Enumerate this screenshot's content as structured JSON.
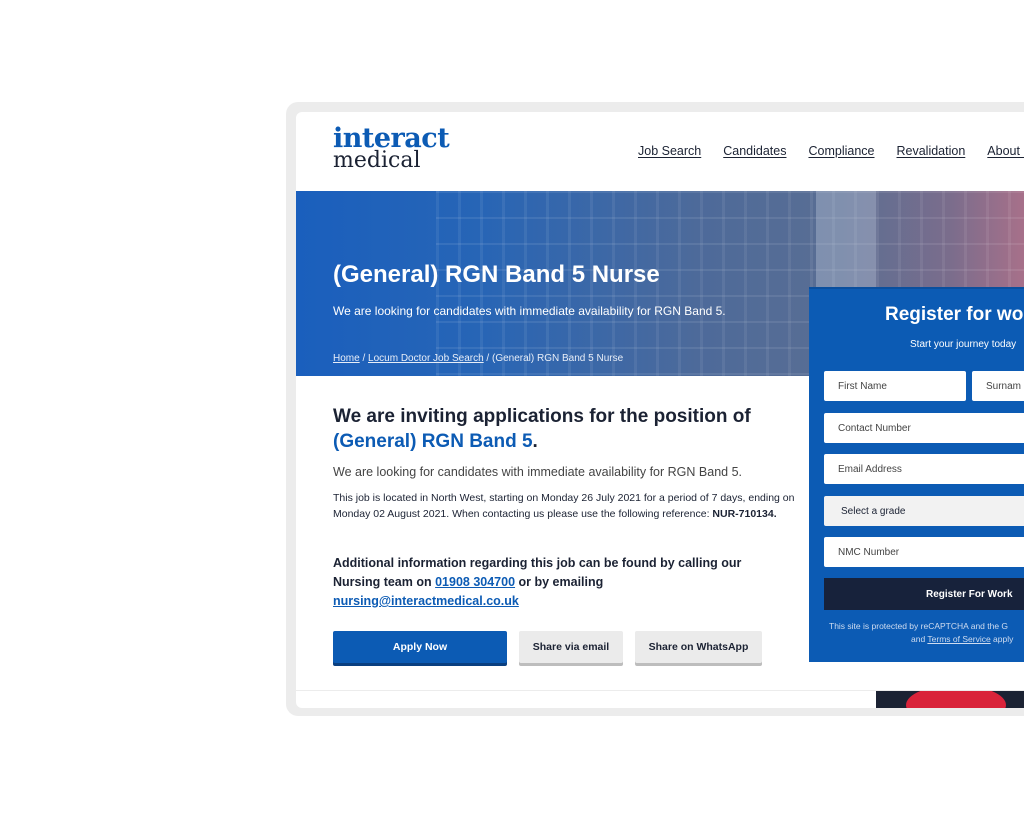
{
  "brand": {
    "line1": "interact",
    "line2": "medical",
    "primary_color": "#0c5bb4",
    "dark_color": "#1b2233"
  },
  "nav": [
    "Job Search",
    "Candidates",
    "Compliance",
    "Revalidation",
    "About U"
  ],
  "hero": {
    "title": "(General) RGN Band 5 Nurse",
    "subtitle": "We are looking for candidates with immediate availability for RGN Band 5.",
    "breadcrumb": {
      "home": "Home",
      "sep": " / ",
      "section": "Locum Doctor Job Search",
      "current": "(General) RGN Band 5 Nurse"
    }
  },
  "main": {
    "heading_prefix": "We are inviting applications for the position of ",
    "heading_role": "(General) RGN Band 5",
    "heading_suffix": ".",
    "lead": "We are looking for candidates with immediate availability for RGN Band 5.",
    "detail": "This job is located in North West, starting on Monday 26 July 2021 for a period of 7 days, ending on Monday 02 August 2021. When contacting us please use the following reference:",
    "reference": "NUR-710134.",
    "contact_prefix": "Additional information regarding this job can be found by calling our Nursing team on ",
    "phone": "01908 304700",
    "contact_mid": " or by emailing ",
    "email": "nursing@interactmedical.co.uk",
    "buttons": {
      "apply": "Apply Now",
      "share_email": "Share via email",
      "share_whatsapp": "Share on WhatsApp"
    }
  },
  "register": {
    "title": "Register for wo",
    "subtitle": "Start your journey today",
    "fields": {
      "first_name": "First Name",
      "surname": "Surnam",
      "contact_number": "Contact Number",
      "email": "Email Address",
      "grade": "Select a grade",
      "nmc": "NMC Number"
    },
    "submit": "Register For Work",
    "note_line1": "This site is protected by reCAPTCHA and the G",
    "note_and": "and ",
    "note_terms": "Terms of Service",
    "note_apply": " apply"
  }
}
